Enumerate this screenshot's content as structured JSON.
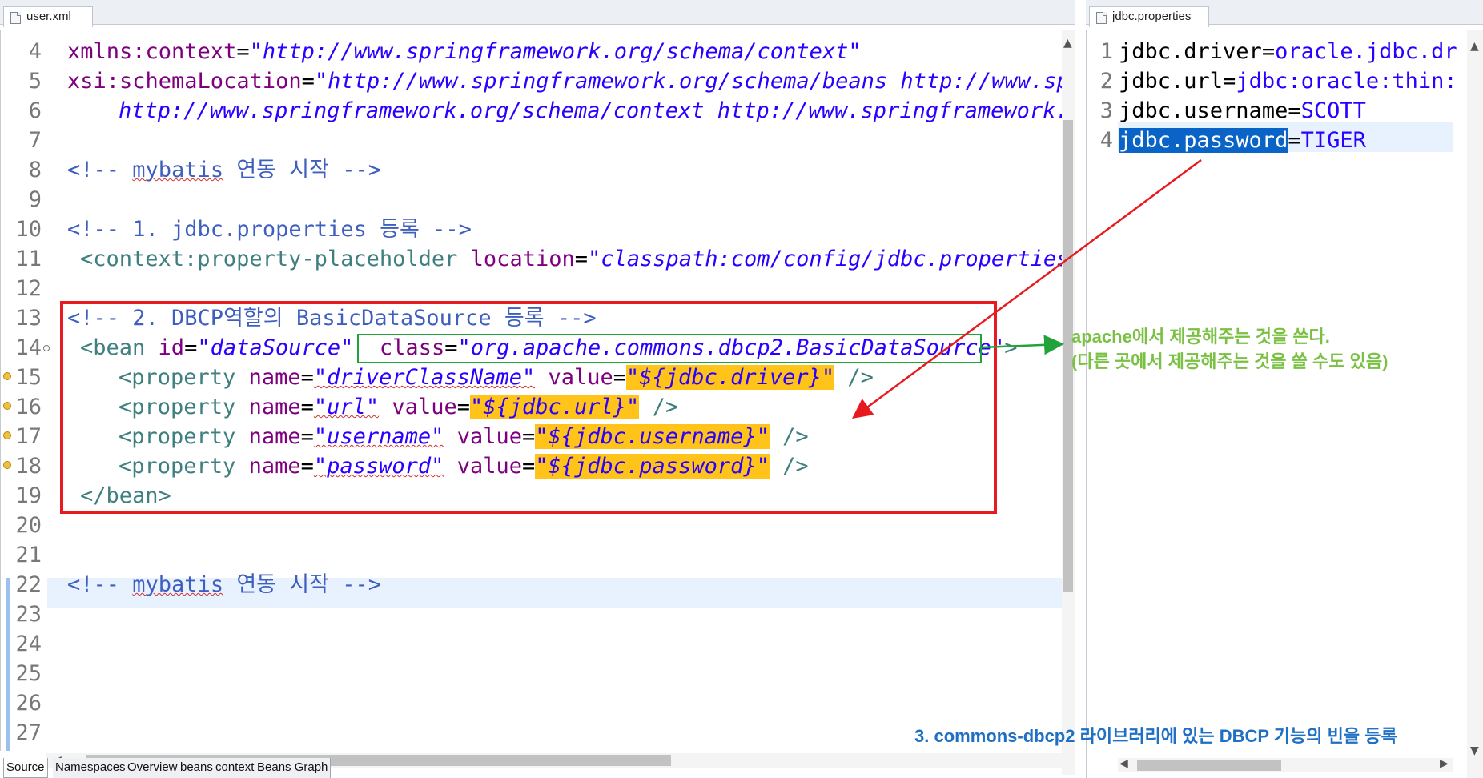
{
  "left_editor": {
    "tab_label": "user.xml",
    "lines": [
      {
        "n": "4"
      },
      {
        "n": "5"
      },
      {
        "n": "6"
      },
      {
        "n": "7"
      },
      {
        "n": "8"
      },
      {
        "n": "9"
      },
      {
        "n": "10"
      },
      {
        "n": "11"
      },
      {
        "n": "12"
      },
      {
        "n": "13"
      },
      {
        "n": "14"
      },
      {
        "n": "15"
      },
      {
        "n": "16"
      },
      {
        "n": "17"
      },
      {
        "n": "18"
      },
      {
        "n": "19"
      },
      {
        "n": "20"
      },
      {
        "n": "21"
      },
      {
        "n": "22"
      },
      {
        "n": "23"
      },
      {
        "n": "24"
      },
      {
        "n": "25"
      },
      {
        "n": "26"
      },
      {
        "n": "27"
      }
    ],
    "code": {
      "l4_attr": "xmlns:context",
      "l4_eq": "=",
      "l4_val": "\"http://www.springframework.org/schema/context\"",
      "l5_attr": "xsi:schemaLocation",
      "l5_eq": "=",
      "l5_val": "\"http://www.springframework.org/schema/beans http://www.sp",
      "l6_val": "http://www.springframework.org/schema/context http://www.springframework.",
      "l8_open": "<!-- ",
      "l8_word": "mybatis",
      "l8_rest": " 연동 시작 -->",
      "l10": "<!-- 1. jdbc.properties 등록 -->",
      "l11_tag": "<context:property-placeholder",
      "l11_attr": "location",
      "l11_eq": "=",
      "l11_val": "\"classpath:com/config/jdbc.properties",
      "l13": "<!-- 2. DBCP역할의 BasicDataSource 등록 -->",
      "l14_tag": "<bean",
      "l14_attr1": "id",
      "l14_eq1": "=",
      "l14_val1": "\"dataSource\"",
      "l14_attr2": "class",
      "l14_eq2": "=",
      "l14_val2": "\"org.apache.commons.dbcp2.BasicDataSource\"",
      "l14_close": ">",
      "l15_tag": "<property",
      "l15_attr1": "name",
      "l15_val1": "\"driverClassName\"",
      "l15_attr2": "value",
      "l15_val2": "\"${jdbc.driver}\"",
      "l15_end": "/>",
      "l16_tag": "<property",
      "l16_attr1": "name",
      "l16_val1": "\"url\"",
      "l16_attr2": "value",
      "l16_val2": "\"${jdbc.url}\"",
      "l16_end": "/>",
      "l17_tag": "<property",
      "l17_attr1": "name",
      "l17_val1": "\"username\"",
      "l17_attr2": "value",
      "l17_val2": "\"${jdbc.username}\"",
      "l17_end": "/>",
      "l18_tag": "<property",
      "l18_attr1": "name",
      "l18_val1": "\"password\"",
      "l18_attr2": "value",
      "l18_val2": "\"${jdbc.password}\"",
      "l18_end": "/>",
      "l19": "</bean>",
      "l22_open": "<!-- ",
      "l22_word": "mybatis",
      "l22_rest": " 연동 시작 -->",
      "eq": "="
    },
    "bottom_tabs": [
      "Source",
      "Namespaces",
      "Overview",
      "beans",
      "context",
      "Beans Graph"
    ],
    "active_bottom_tab": "Source"
  },
  "right_editor": {
    "tab_label": "jdbc.properties",
    "lines": [
      {
        "n": "1",
        "key": "jdbc.driver",
        "eq": "=",
        "val": "oracle.jdbc.dr"
      },
      {
        "n": "2",
        "key": "jdbc.url",
        "eq": "=",
        "val": "jdbc:oracle:thin:"
      },
      {
        "n": "3",
        "key": "jdbc.username",
        "eq": "=",
        "val": "SCOTT"
      },
      {
        "n": "4",
        "key": "jdbc.password",
        "eq": "=",
        "val": "TIGER"
      }
    ]
  },
  "annotations": {
    "apache_note_line1": "apache에서 제공해주는 것을 쓴다.",
    "apache_note_line2": "(다른 곳에서 제공해주는 것을 쓸 수도 있음)",
    "dbcp_note": "3. commons-dbcp2 라이브러리에 있는 DBCP 기능의 빈을 등록",
    "colors": {
      "red_box": "#e8191f",
      "green_box": "#22a33a",
      "green_text": "#7ac143",
      "blue_text": "#1f6fc4",
      "highlight": "#ffc31a",
      "selection": "#0a64c8"
    }
  }
}
